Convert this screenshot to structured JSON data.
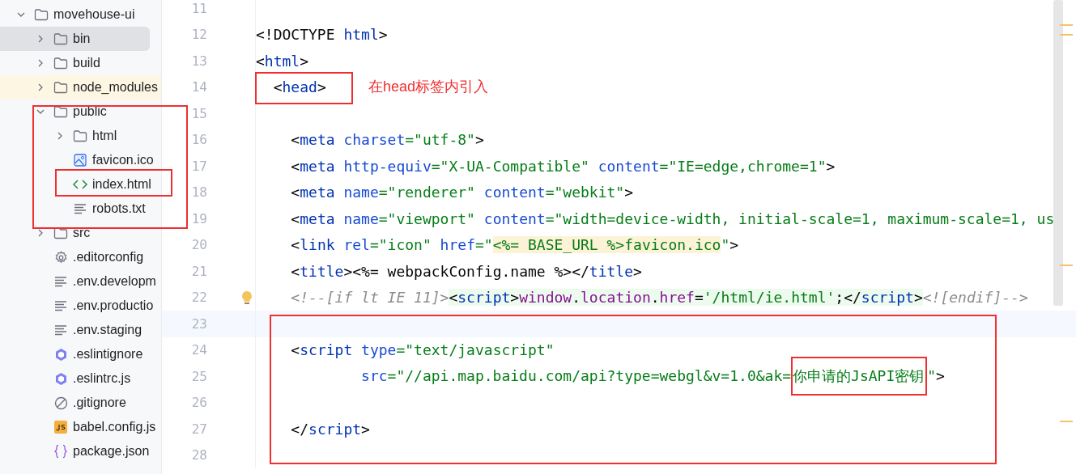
{
  "project_tree": [
    {
      "name": "movehouse-ui",
      "kind": "folder",
      "expanded": true,
      "selected": false,
      "ignored": false,
      "children": [
        {
          "name": "bin",
          "kind": "folder",
          "expanded": false,
          "selected": true,
          "ignored": false
        },
        {
          "name": "build",
          "kind": "folder",
          "expanded": false,
          "selected": false,
          "ignored": false
        },
        {
          "name": "node_modules",
          "kind": "folder",
          "expanded": false,
          "selected": false,
          "ignored": true
        },
        {
          "name": "public",
          "kind": "folder",
          "expanded": true,
          "selected": false,
          "ignored": false,
          "children": [
            {
              "name": "html",
              "kind": "folder",
              "expanded": false,
              "selected": false,
              "ignored": false
            },
            {
              "name": "favicon.ico",
              "kind": "image",
              "selected": false,
              "ignored": false
            },
            {
              "name": "index.html",
              "kind": "html",
              "selected": false,
              "ignored": false
            },
            {
              "name": "robots.txt",
              "kind": "text",
              "selected": false,
              "ignored": false
            }
          ]
        },
        {
          "name": "src",
          "kind": "folder",
          "expanded": false,
          "selected": false,
          "ignored": false
        },
        {
          "name": ".editorconfig",
          "kind": "config",
          "selected": false,
          "ignored": false
        },
        {
          "name": ".env.developm",
          "kind": "text",
          "selected": false,
          "ignored": false
        },
        {
          "name": ".env.productio",
          "kind": "text",
          "selected": false,
          "ignored": false
        },
        {
          "name": ".env.staging",
          "kind": "text",
          "selected": false,
          "ignored": false
        },
        {
          "name": ".eslintignore",
          "kind": "eslint",
          "selected": false,
          "ignored": false
        },
        {
          "name": ".eslintrc.js",
          "kind": "eslint",
          "selected": false,
          "ignored": false
        },
        {
          "name": ".gitignore",
          "kind": "ignore",
          "selected": false,
          "ignored": false
        },
        {
          "name": "babel.config.js",
          "kind": "js",
          "selected": false,
          "ignored": false
        },
        {
          "name": "package.json",
          "kind": "json",
          "selected": false,
          "ignored": false
        }
      ]
    }
  ],
  "editor": {
    "callout": "在head标签内引入",
    "lines": [
      {
        "number": "11",
        "current": false,
        "intention": false
      },
      {
        "number": "12",
        "current": false,
        "intention": false,
        "tokens": [
          {
            "text": "<!DOCTYPE",
            "kind": "punct"
          },
          {
            "text": " html",
            "kind": "tag"
          },
          {
            "text": ">",
            "kind": "punct"
          }
        ]
      },
      {
        "number": "13",
        "current": false,
        "intention": false,
        "tokens": [
          {
            "text": "<",
            "kind": "punct"
          },
          {
            "text": "html",
            "kind": "tag"
          },
          {
            "text": ">",
            "kind": "punct"
          }
        ]
      },
      {
        "number": "14",
        "current": false,
        "intention": false,
        "tokens": [
          {
            "text": "  <",
            "kind": "punct"
          },
          {
            "text": "head",
            "kind": "tag"
          },
          {
            "text": ">",
            "kind": "punct"
          }
        ]
      },
      {
        "number": "15",
        "current": false,
        "intention": false
      },
      {
        "number": "16",
        "current": false,
        "intention": false,
        "tokens": [
          {
            "text": "    <",
            "kind": "punct"
          },
          {
            "text": "meta",
            "kind": "tag"
          },
          {
            "text": " charset",
            "kind": "attr"
          },
          {
            "text": "=\"utf-8\"",
            "kind": "string"
          },
          {
            "text": ">",
            "kind": "punct"
          }
        ]
      },
      {
        "number": "17",
        "current": false,
        "intention": false,
        "tokens": [
          {
            "text": "    <",
            "kind": "punct"
          },
          {
            "text": "meta",
            "kind": "tag"
          },
          {
            "text": " http-equiv",
            "kind": "attr"
          },
          {
            "text": "=\"X-UA-Compatible\"",
            "kind": "string"
          },
          {
            "text": " content",
            "kind": "attr"
          },
          {
            "text": "=\"IE=edge,chrome=1\"",
            "kind": "string"
          },
          {
            "text": ">",
            "kind": "punct"
          }
        ]
      },
      {
        "number": "18",
        "current": false,
        "intention": false,
        "tokens": [
          {
            "text": "    <",
            "kind": "punct"
          },
          {
            "text": "meta",
            "kind": "tag"
          },
          {
            "text": " name",
            "kind": "attr"
          },
          {
            "text": "=\"renderer\"",
            "kind": "string"
          },
          {
            "text": " content",
            "kind": "attr"
          },
          {
            "text": "=\"webkit\"",
            "kind": "string"
          },
          {
            "text": ">",
            "kind": "punct"
          }
        ]
      },
      {
        "number": "19",
        "current": false,
        "intention": false,
        "tokens": [
          {
            "text": "    <",
            "kind": "punct"
          },
          {
            "text": "meta",
            "kind": "tag"
          },
          {
            "text": " name",
            "kind": "attr"
          },
          {
            "text": "=\"viewport\"",
            "kind": "string"
          },
          {
            "text": " content",
            "kind": "attr"
          },
          {
            "text": "=\"width=device-width, initial-scale=1, maximum-scale=1, us",
            "kind": "string"
          }
        ]
      },
      {
        "number": "20",
        "current": false,
        "intention": false,
        "tokens": [
          {
            "text": "    <",
            "kind": "punct"
          },
          {
            "text": "link",
            "kind": "tag"
          },
          {
            "text": " rel",
            "kind": "attr"
          },
          {
            "text": "=\"icon\"",
            "kind": "string"
          },
          {
            "text": " href",
            "kind": "attr"
          },
          {
            "text": "=\"",
            "kind": "string"
          },
          {
            "text": "<%= BASE_URL %>favicon.ico",
            "kind": "template"
          },
          {
            "text": "\"",
            "kind": "string"
          },
          {
            "text": ">",
            "kind": "punct"
          }
        ]
      },
      {
        "number": "21",
        "current": false,
        "intention": false,
        "tokens": [
          {
            "text": "    <",
            "kind": "punct"
          },
          {
            "text": "title",
            "kind": "tag"
          },
          {
            "text": ">",
            "kind": "punct"
          },
          {
            "text": "<%= webpackConfig.name %>",
            "kind": "punct"
          },
          {
            "text": "</",
            "kind": "punct"
          },
          {
            "text": "title",
            "kind": "tag"
          },
          {
            "text": ">",
            "kind": "punct"
          }
        ]
      },
      {
        "number": "22",
        "current": false,
        "intention": true,
        "tokens": [
          {
            "text": "    <!--[if lt IE 11]>",
            "kind": "comment"
          },
          {
            "text": "<",
            "kind": "punct",
            "injected": true
          },
          {
            "text": "script",
            "kind": "tag",
            "injected": true
          },
          {
            "text": ">",
            "kind": "punct",
            "injected": true
          },
          {
            "text": "window",
            "kind": "js",
            "injected": true
          },
          {
            "text": ".",
            "kind": "punct",
            "injected": true
          },
          {
            "text": "location",
            "kind": "js",
            "injected": true
          },
          {
            "text": ".",
            "kind": "punct",
            "injected": true
          },
          {
            "text": "href",
            "kind": "js",
            "injected": true
          },
          {
            "text": "=",
            "kind": "punct",
            "injected": true
          },
          {
            "text": "'/html/ie.html'",
            "kind": "string",
            "injected": true
          },
          {
            "text": ";</",
            "kind": "punct",
            "injected": true
          },
          {
            "text": "script",
            "kind": "tag",
            "injected": true
          },
          {
            "text": ">",
            "kind": "punct",
            "injected": true
          },
          {
            "text": "<![endif]-->",
            "kind": "comment"
          }
        ]
      },
      {
        "number": "23",
        "current": true,
        "intention": false
      },
      {
        "number": "24",
        "current": false,
        "intention": false,
        "tokens": [
          {
            "text": "    <",
            "kind": "punct"
          },
          {
            "text": "script",
            "kind": "tag"
          },
          {
            "text": " type",
            "kind": "attr"
          },
          {
            "text": "=\"text/javascript\"",
            "kind": "string"
          }
        ]
      },
      {
        "number": "25",
        "current": false,
        "intention": false,
        "tokens": [
          {
            "text": "            src",
            "kind": "attr"
          },
          {
            "text": "=\"//api.map.baidu.com/api?type=webgl&v=1.0&ak=",
            "kind": "string"
          },
          {
            "text": "你申请的JsAPI密钥",
            "kind": "string",
            "annotated": true
          },
          {
            "text": "\"",
            "kind": "string"
          },
          {
            "text": ">",
            "kind": "punct"
          }
        ]
      },
      {
        "number": "26",
        "current": false,
        "intention": false
      },
      {
        "number": "27",
        "current": false,
        "intention": false,
        "tokens": [
          {
            "text": "    </",
            "kind": "punct"
          },
          {
            "text": "script",
            "kind": "tag"
          },
          {
            "text": ">",
            "kind": "punct"
          }
        ]
      },
      {
        "number": "28",
        "current": false,
        "intention": false
      }
    ]
  }
}
